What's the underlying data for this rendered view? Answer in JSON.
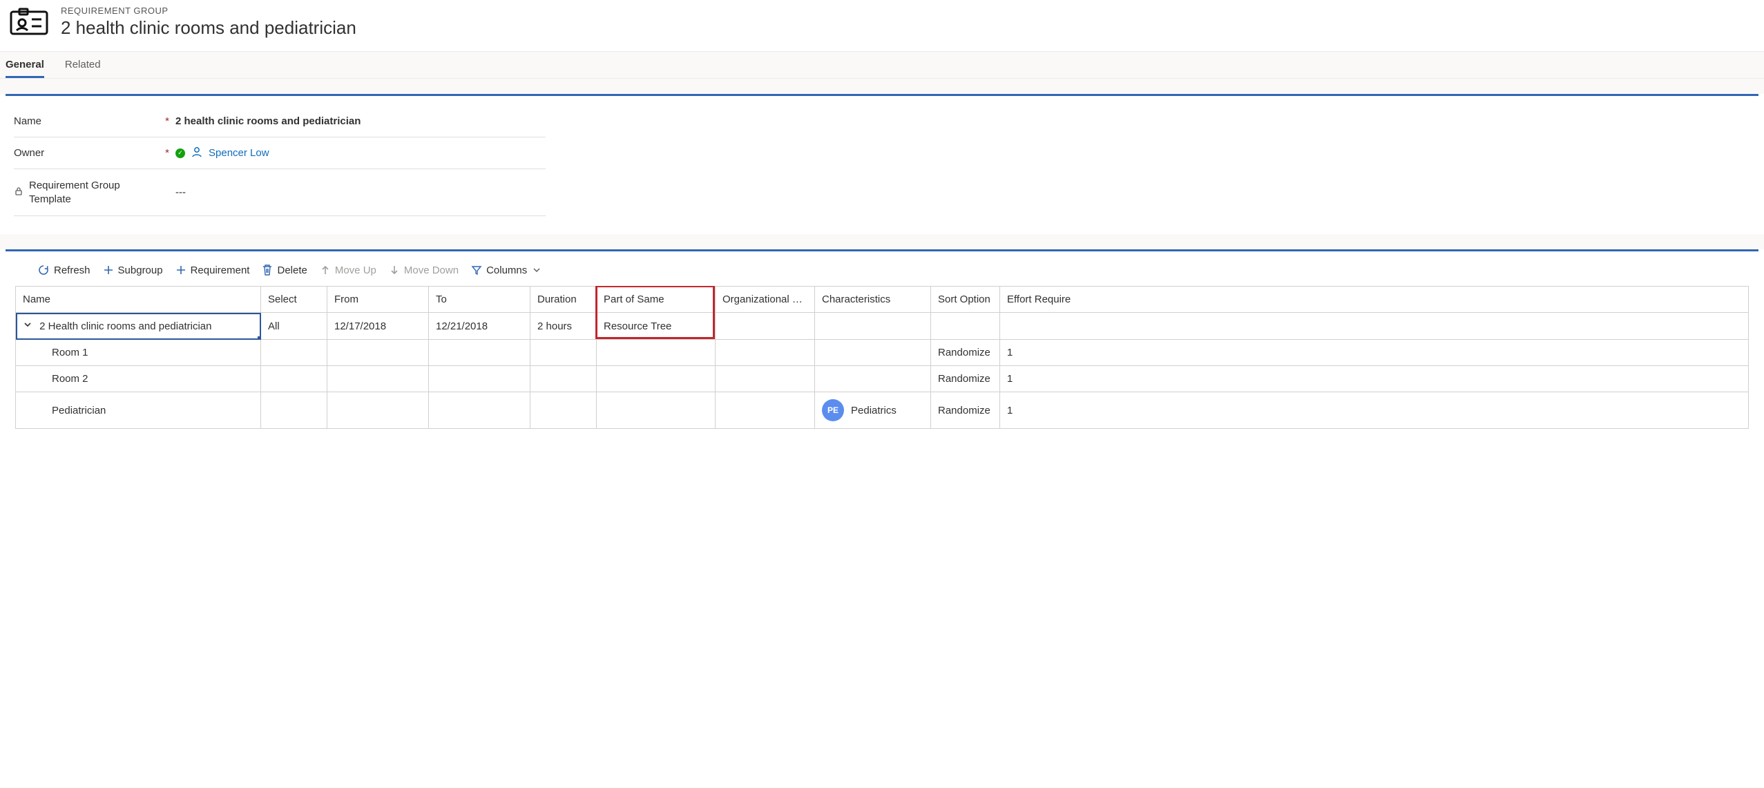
{
  "header": {
    "entity_label": "REQUIREMENT GROUP",
    "title": "2 health clinic rooms and pediatrician"
  },
  "tabs": {
    "general": "General",
    "related": "Related"
  },
  "form": {
    "name_label": "Name",
    "name_value": "2 health clinic rooms and pediatrician",
    "owner_label": "Owner",
    "owner_value": "Spencer Low",
    "template_label": "Requirement Group Template",
    "template_value": "---"
  },
  "toolbar": {
    "refresh": "Refresh",
    "subgroup": "Subgroup",
    "requirement": "Requirement",
    "delete": "Delete",
    "moveup": "Move Up",
    "movedown": "Move Down",
    "columns": "Columns"
  },
  "grid": {
    "columns": {
      "name": "Name",
      "select": "Select",
      "from": "From",
      "to": "To",
      "duration": "Duration",
      "partofsame": "Part of Same",
      "orgunit": "Organizational Unit",
      "characteristics": "Characteristics",
      "sort": "Sort Option",
      "effort": "Effort Require"
    },
    "rows": [
      {
        "name": "2 Health clinic rooms and pediatrician",
        "select": "All",
        "from": "12/17/2018",
        "to": "12/21/2018",
        "duration": "2 hours",
        "partofsame": "Resource Tree",
        "orgunit": "",
        "characteristics": "",
        "char_initials": "",
        "sort": "",
        "effort": ""
      },
      {
        "name": "Room 1",
        "select": "",
        "from": "",
        "to": "",
        "duration": "",
        "partofsame": "",
        "orgunit": "",
        "characteristics": "",
        "char_initials": "",
        "sort": "Randomize",
        "effort": "1"
      },
      {
        "name": "Room 2",
        "select": "",
        "from": "",
        "to": "",
        "duration": "",
        "partofsame": "",
        "orgunit": "",
        "characteristics": "",
        "char_initials": "",
        "sort": "Randomize",
        "effort": "1"
      },
      {
        "name": "Pediatrician",
        "select": "",
        "from": "",
        "to": "",
        "duration": "",
        "partofsame": "",
        "orgunit": "",
        "characteristics": "Pediatrics",
        "char_initials": "PE",
        "sort": "Randomize",
        "effort": "1"
      }
    ]
  }
}
